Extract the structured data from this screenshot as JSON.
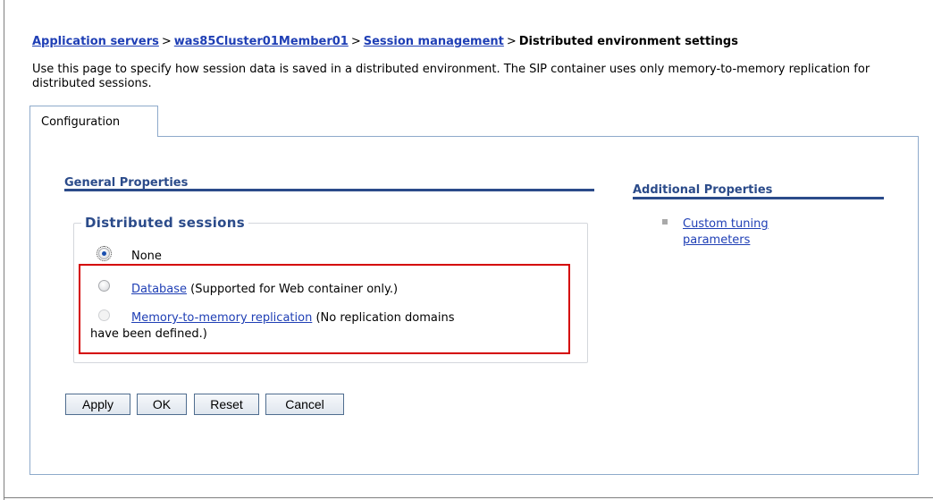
{
  "breadcrumb": {
    "items": [
      "Application servers",
      "was85Cluster01Member01",
      "Session management"
    ],
    "separator": ">",
    "current": "Distributed environment settings"
  },
  "description": "Use this page to specify how session data is saved in a distributed environment. The SIP container uses only memory-to-memory replication for distributed sessions.",
  "tabs": {
    "configuration": "Configuration"
  },
  "general_properties": {
    "title": "General Properties",
    "fieldset_label": "Distributed sessions",
    "options": [
      {
        "label": "None",
        "checked": true,
        "enabled": true
      },
      {
        "link": "Database",
        "note": " (Supported for Web container only.)",
        "checked": false,
        "enabled": true
      },
      {
        "link": "Memory-to-memory replication",
        "note": " (No replication domains",
        "note2": "have been defined.)",
        "checked": false,
        "enabled": false
      }
    ]
  },
  "additional_properties": {
    "title": "Additional Properties",
    "link_line1": "Custom tuning",
    "link_line2": "parameters"
  },
  "buttons": {
    "apply": "Apply",
    "ok": "OK",
    "reset": "Reset",
    "cancel": "Cancel"
  },
  "colors": {
    "link": "#1f3fb5",
    "section": "#2b4b8a",
    "highlight": "#d40000"
  }
}
